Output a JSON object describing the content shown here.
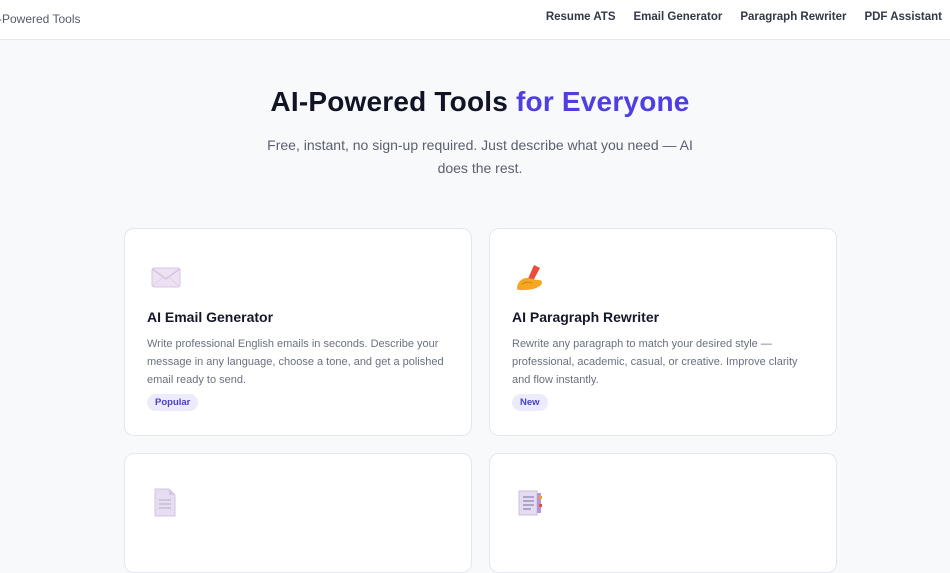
{
  "header": {
    "brand": "-Powered Tools",
    "nav": [
      "Resume ATS",
      "Email Generator",
      "Paragraph Rewriter",
      "PDF Assistant"
    ]
  },
  "hero": {
    "title_main": "AI-Powered Tools ",
    "title_accent": "for Everyone",
    "subtitle": "Free, instant, no sign-up required. Just describe what you need — AI does the rest."
  },
  "cards": [
    {
      "icon": "envelope-icon",
      "title": "AI Email Generator",
      "description": "Write professional English emails in seconds. Describe your message in any language, choose a tone, and get a polished email ready to send.",
      "badge": "Popular"
    },
    {
      "icon": "writing-hand-icon",
      "title": "AI Paragraph Rewriter",
      "description": "Rewrite any paragraph to match your desired style — professional, academic, casual, or creative. Improve clarity and flow instantly.",
      "badge": "New"
    },
    {
      "icon": "document-icon"
    },
    {
      "icon": "resume-document-icon"
    }
  ],
  "colors": {
    "accent": "#4f3fe0",
    "badge_bg": "#ecebfb",
    "page_bg": "#f8f9fb"
  }
}
